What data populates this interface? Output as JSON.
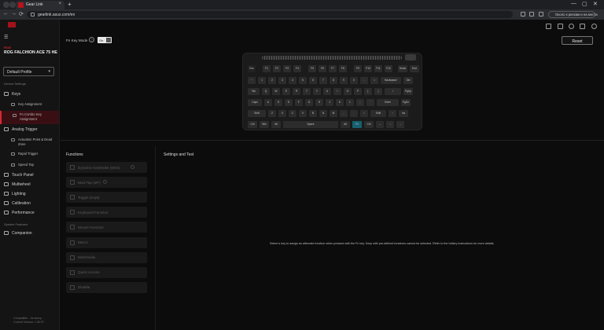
{
  "browser": {
    "tab_title": "Gear Link",
    "tab_close": "×",
    "new_tab": "+",
    "back": "←",
    "forward": "→",
    "reload": "⟳",
    "url": "gearlink.asus.com/en",
    "update_text": "Около к рискам и на места",
    "win_min": "—",
    "win_max": "▢",
    "win_close": "✕"
  },
  "sidebar": {
    "menu_icon": "☰",
    "brand_mark": "ROG",
    "device_name": "ROG FALCHION ACE 75 HE",
    "profile": "Default Profile",
    "profile_chevron": "▾",
    "device_settings_label": "Device Settings",
    "items": [
      {
        "label": "Keys",
        "icon": "keyboard-icon"
      },
      {
        "label": "Key Assignment",
        "icon": "key-assign-icon"
      },
      {
        "label": "Fn Combo Key Assignment",
        "icon": "fn-combo-icon"
      },
      {
        "label": "Analog Trigger",
        "icon": "analog-icon"
      },
      {
        "label": "Actuation Point & Dead Zone",
        "icon": "actuation-icon"
      },
      {
        "label": "Rapid Trigger",
        "icon": "rapid-icon"
      },
      {
        "label": "Speed Tap",
        "icon": "speedtap-icon"
      },
      {
        "label": "Touch Panel",
        "icon": "touch-icon"
      },
      {
        "label": "Multiwheel",
        "icon": "wheel-icon"
      },
      {
        "label": "Lighting",
        "icon": "lighting-icon"
      },
      {
        "label": "Calibration",
        "icon": "calibration-icon"
      },
      {
        "label": "Performance",
        "icon": "performance-icon"
      }
    ],
    "system_features_label": "System Features",
    "companion": "Companion",
    "compat_line1": "Compatible – Armoury...",
    "compat_line2": "Current Version: 1.00.07"
  },
  "main": {
    "fn_key_mode_label": "Fn Key Mode",
    "help": "?",
    "toggle_label": "On",
    "reset_label": "Reset",
    "functions_title": "Functions",
    "functions": [
      "Dynamic Keystroke (DKS)",
      "Mod-Tap (MT)",
      "Toggle (Kept)",
      "Keyboard Function",
      "Mouse Function",
      "Macro",
      "Multimedia",
      "Quick Access",
      "Disable"
    ],
    "settings_title": "Settings and Test",
    "instruction": "Select a key to assign an alternate function when pressed with the Fn key. Keys with pre-defined functions cannot be selected. Refer to the hotkey instructions for more details."
  },
  "keyboard": {
    "row0": [
      "Esc",
      "F1",
      "F2",
      "F3",
      "F4",
      "F5",
      "F6",
      "F7",
      "F8",
      "F9",
      "F10",
      "F11",
      "F12",
      "Home",
      "End"
    ],
    "row1": [
      "~",
      "1",
      "2",
      "3",
      "4",
      "5",
      "6",
      "7",
      "8",
      "9",
      "0",
      "-",
      "=",
      "Backspace",
      "Del"
    ],
    "row2": [
      "Tab",
      "Q",
      "W",
      "E",
      "R",
      "T",
      "Y",
      "U",
      "I",
      "O",
      "P",
      "[",
      "]",
      "\\",
      "PgUp"
    ],
    "row3": [
      "Caps",
      "A",
      "S",
      "D",
      "F",
      "G",
      "H",
      "J",
      "K",
      "L",
      ";",
      "'",
      "Enter",
      "PgDn"
    ],
    "row4": [
      "Shift",
      "Z",
      "X",
      "C",
      "V",
      "B",
      "N",
      "M",
      ",",
      ".",
      "/",
      "Shift",
      "↑",
      "Ins"
    ],
    "row5": [
      "Ctrl",
      "Win",
      "Alt",
      "Space",
      "Alt",
      "Fn",
      "Ctrl",
      "←",
      "↓",
      "→"
    ]
  },
  "colors": {
    "accent": "#d52a33",
    "highlight_key": "#16606f"
  }
}
